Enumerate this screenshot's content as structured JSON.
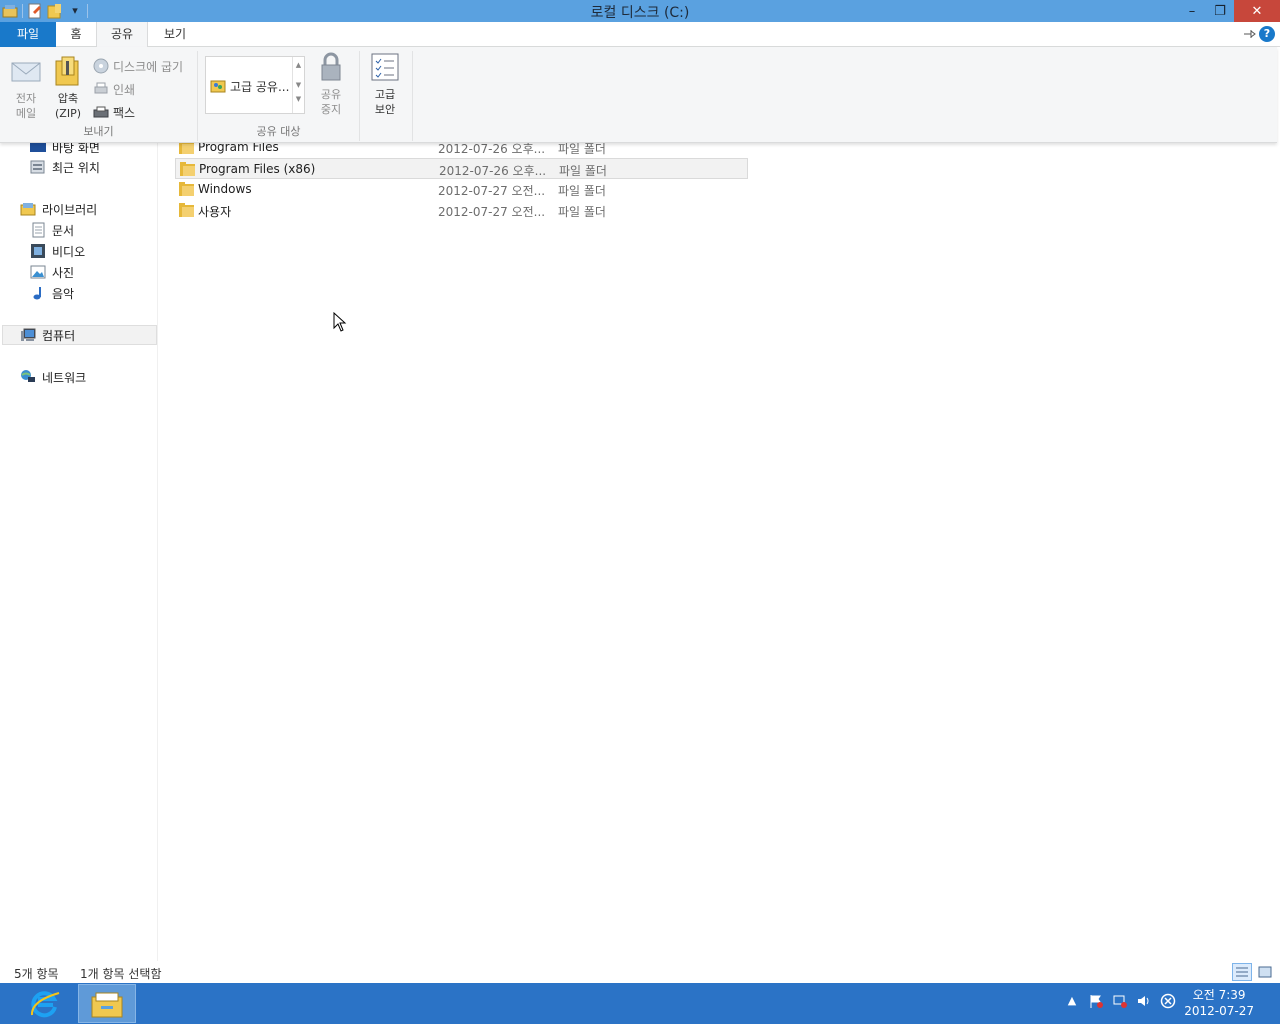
{
  "window": {
    "title": "로컬 디스크 (C:)",
    "accent": "#5aa1e0",
    "controls": {
      "minimize": "–",
      "restore": "❐",
      "close": "✕"
    }
  },
  "quick_access": {
    "dropdown": "▾"
  },
  "ribbon": {
    "tabs": [
      {
        "label": "파일"
      },
      {
        "label": "홈"
      },
      {
        "label": "공유"
      },
      {
        "label": "보기"
      }
    ],
    "help": "?",
    "send_group": {
      "label": "보내기",
      "email": "전자\n메일",
      "zip_line1": "압축",
      "zip_line2": "(ZIP)",
      "burn": "디스크에 굽기",
      "print": "인쇄",
      "fax": "팩스"
    },
    "share_group": {
      "label": "공유 대상",
      "gallery_item": "고급 공유...",
      "stop_line1": "공유",
      "stop_line2": "중지"
    },
    "security": {
      "line1": "고급",
      "line2": "보안"
    }
  },
  "nav": {
    "desktop": "바탕 화면",
    "recent": "최근 위치",
    "libraries": "라이브러리",
    "documents": "문서",
    "videos": "비디오",
    "pictures": "사진",
    "music": "음악",
    "computer": "컴퓨터",
    "network": "네트워크"
  },
  "files": [
    {
      "name": "Program Files",
      "date": "2012-07-26 오후...",
      "type": "파일 폴더"
    },
    {
      "name": "Program Files (x86)",
      "date": "2012-07-26 오후...",
      "type": "파일 폴더"
    },
    {
      "name": "Windows",
      "date": "2012-07-27 오전...",
      "type": "파일 폴더"
    },
    {
      "name": "사용자",
      "date": "2012-07-27 오전...",
      "type": "파일 폴더"
    }
  ],
  "status": {
    "item_count": "5개 항목",
    "selected": "1개 항목 선택함"
  },
  "taskbar": {
    "color": "#2b73c6",
    "time": "오전 7:39",
    "date": "2012-07-27"
  }
}
